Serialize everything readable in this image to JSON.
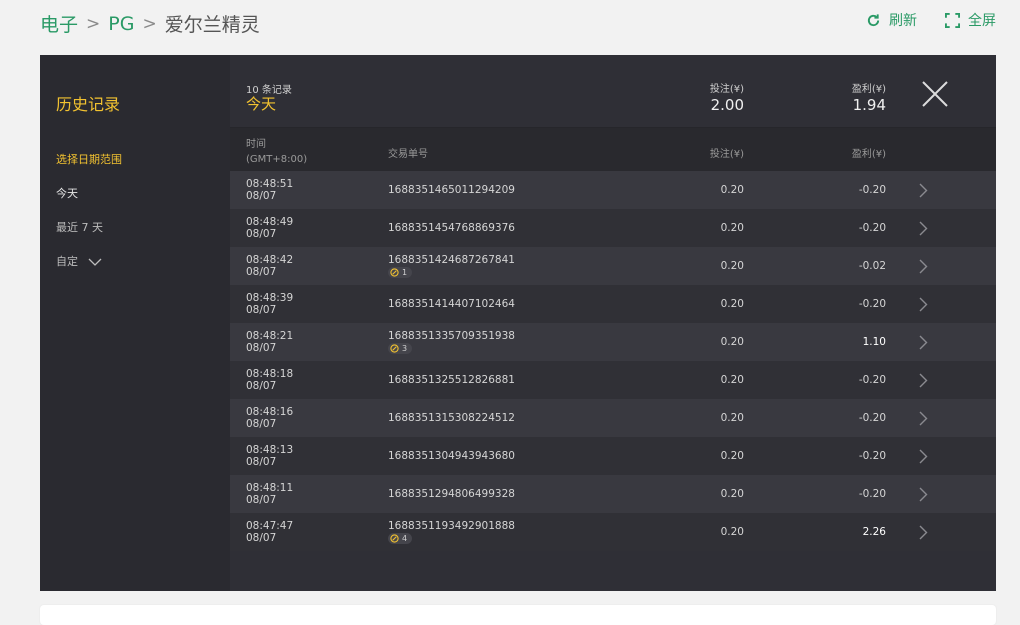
{
  "breadcrumb": {
    "items": [
      "电子",
      "PG",
      "爱尔兰精灵"
    ],
    "separator": ">"
  },
  "actions": {
    "refresh_label": "刷新",
    "fullscreen_label": "全屏"
  },
  "sidebar": {
    "title": "历史记录",
    "date_range_label": "选择日期范围",
    "options": [
      "今天",
      "最近 7 天",
      "自定"
    ]
  },
  "summary": {
    "count_text": "10 条记录",
    "range_text": "今天",
    "bet_label": "投注(¥)",
    "bet_total": "2.00",
    "pnl_label": "盈利(¥)",
    "pnl_total": "1.94"
  },
  "table": {
    "headers": {
      "time": "时间",
      "timezone": "(GMT+8:00)",
      "id": "交易单号",
      "bet": "投注(¥)",
      "pnl": "盈利(¥)"
    },
    "rows": [
      {
        "time": "08:48:51",
        "date": "08/07",
        "id": "1688351465011294209",
        "free": "",
        "bet": "0.20",
        "pnl": "-0.20"
      },
      {
        "time": "08:48:49",
        "date": "08/07",
        "id": "1688351454768869376",
        "free": "",
        "bet": "0.20",
        "pnl": "-0.20"
      },
      {
        "time": "08:48:42",
        "date": "08/07",
        "id": "1688351424687267841",
        "free": "1",
        "bet": "0.20",
        "pnl": "-0.02"
      },
      {
        "time": "08:48:39",
        "date": "08/07",
        "id": "1688351414407102464",
        "free": "",
        "bet": "0.20",
        "pnl": "-0.20"
      },
      {
        "time": "08:48:21",
        "date": "08/07",
        "id": "1688351335709351938",
        "free": "3",
        "bet": "0.20",
        "pnl": "1.10"
      },
      {
        "time": "08:48:18",
        "date": "08/07",
        "id": "1688351325512826881",
        "free": "",
        "bet": "0.20",
        "pnl": "-0.20"
      },
      {
        "time": "08:48:16",
        "date": "08/07",
        "id": "1688351315308224512",
        "free": "",
        "bet": "0.20",
        "pnl": "-0.20"
      },
      {
        "time": "08:48:13",
        "date": "08/07",
        "id": "1688351304943943680",
        "free": "",
        "bet": "0.20",
        "pnl": "-0.20"
      },
      {
        "time": "08:48:11",
        "date": "08/07",
        "id": "1688351294806499328",
        "free": "",
        "bet": "0.20",
        "pnl": "-0.20"
      },
      {
        "time": "08:47:47",
        "date": "08/07",
        "id": "1688351193492901888",
        "free": "4",
        "bet": "0.20",
        "pnl": "2.26"
      }
    ]
  },
  "colors": {
    "accent_green": "#2a9a66",
    "accent_gold": "#f2c230",
    "panel_bg": "#2f2f36"
  },
  "icons": {
    "refresh": "refresh-icon",
    "fullscreen": "fullscreen-icon",
    "close": "close-icon",
    "row_arrow": "chevron-right-icon",
    "free_spin": "free-spin-icon"
  }
}
